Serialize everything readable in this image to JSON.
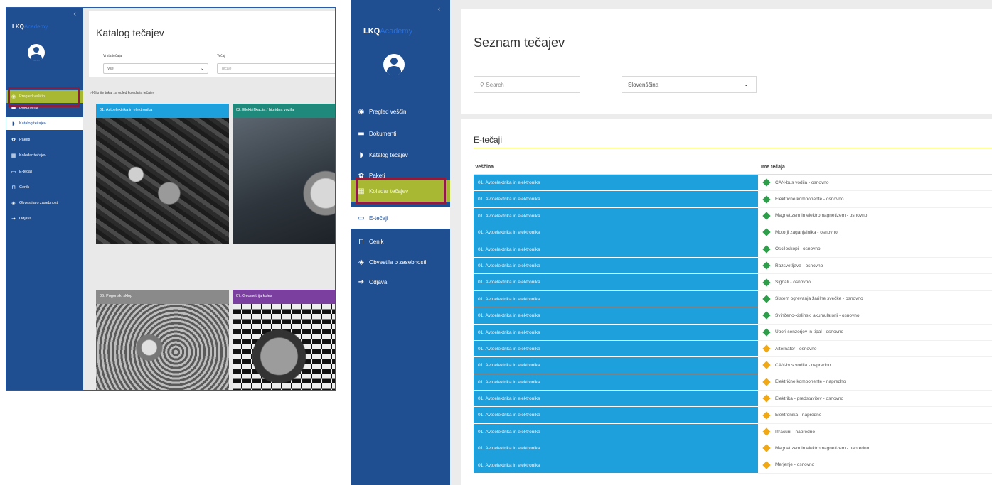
{
  "panel1": {
    "sidebar": {
      "logo_main": "LKQ",
      "logo_tail": "Academy",
      "items": [
        {
          "label": "Pregled veščin",
          "icon": "dashboard-icon"
        },
        {
          "label": "Dokumenti",
          "icon": "folder-icon"
        },
        {
          "label": "Katalog tečajev",
          "icon": "bookmark-icon"
        },
        {
          "label": "Paketi",
          "icon": "package-icon"
        },
        {
          "label": "Koledar tečajev",
          "icon": "calendar-icon"
        },
        {
          "label": "E-tečaji",
          "icon": "monitor-icon"
        },
        {
          "label": "Cenik",
          "icon": "price-tag-icon"
        },
        {
          "label": "Obvestila o zasebnosti",
          "icon": "privacy-icon"
        },
        {
          "label": "Odjava",
          "icon": "logout-icon"
        }
      ]
    },
    "header": {
      "title": "Katalog tečajev",
      "filter_type_label": "Vrsta tečaja",
      "filter_type_value": "Vse",
      "filter_course_label": "Tečaj",
      "filter_course_placeholder": "Tečaje"
    },
    "catalog_link": "Kliknite tukaj za ogled koledarja tečajev",
    "cards": [
      {
        "title": "01. Avtoelektrika in elektronika",
        "color": "#1ea0dc"
      },
      {
        "title": "02. Elektrifikacija / hibridna vozila",
        "color": "#1f8a7c"
      },
      {
        "title": "06. Pogonski sklop",
        "color": "#8a8a8a"
      },
      {
        "title": "07. Geometrija koles",
        "color": "#7b3fa0"
      }
    ]
  },
  "panel2": {
    "sidebar": {
      "logo_main": "LKQ",
      "logo_tail": "Academy",
      "items": [
        {
          "label": "Pregled veščin",
          "icon": "dashboard-icon"
        },
        {
          "label": "Dokumenti",
          "icon": "folder-icon"
        },
        {
          "label": "Katalog tečajev",
          "icon": "bookmark-icon"
        },
        {
          "label": "Paketi",
          "icon": "package-icon"
        },
        {
          "label": "Koledar tečajev",
          "icon": "calendar-icon"
        },
        {
          "label": "E-tečaji",
          "icon": "monitor-icon"
        },
        {
          "label": "Cenik",
          "icon": "price-tag-icon"
        },
        {
          "label": "Obvestila o zasebnosti",
          "icon": "privacy-icon"
        },
        {
          "label": "Odjava",
          "icon": "logout-icon"
        }
      ]
    },
    "header": {
      "title": "Seznam tečajev",
      "search_placeholder": "Search",
      "language_value": "Slovenščina"
    },
    "section_title": "E-tečaji",
    "columns": [
      "Veščina",
      "Ime tečaja"
    ],
    "level_colors": {
      "osnovno": "#2e9e4a",
      "napredno": "#f0a814"
    },
    "rows": [
      {
        "skill": "01. Avtoelektrika in elektronika",
        "course": "CAN-bus vodila - osnovno",
        "level": "osnovno"
      },
      {
        "skill": "01. Avtoelektrika in elektronika",
        "course": "Električne komponente - osnovno",
        "level": "osnovno"
      },
      {
        "skill": "01. Avtoelektrika in elektronika",
        "course": "Magnetizem in elektromagnetizem - osnovno",
        "level": "osnovno"
      },
      {
        "skill": "01. Avtoelektrika in elektronika",
        "course": "Motorji zaganjalnika - osnovno",
        "level": "osnovno"
      },
      {
        "skill": "01. Avtoelektrika in elektronika",
        "course": "Osciloskopi - osnovno",
        "level": "osnovno"
      },
      {
        "skill": "01. Avtoelektrika in elektronika",
        "course": "Razsvetljava - osnovno",
        "level": "osnovno"
      },
      {
        "skill": "01. Avtoelektrika in elektronika",
        "course": "Signali - osnovno",
        "level": "osnovno"
      },
      {
        "skill": "01. Avtoelektrika in elektronika",
        "course": "Sistem ogrevanja žarilne svečke - osnovno",
        "level": "osnovno"
      },
      {
        "skill": "01. Avtoelektrika in elektronika",
        "course": "Svinčeno-kislinski akumulatorji - osnovno",
        "level": "osnovno"
      },
      {
        "skill": "01. Avtoelektrika in elektronika",
        "course": "Upori senzorjev in tipal - osnovno",
        "level": "osnovno"
      },
      {
        "skill": "01. Avtoelektrika in elektronika",
        "course": "Alternator - osnovno",
        "level": "napredno"
      },
      {
        "skill": "01. Avtoelektrika in elektronika",
        "course": "CAN-bus vodila - napredno",
        "level": "napredno"
      },
      {
        "skill": "01. Avtoelektrika in elektronika",
        "course": "Električne komponente - napredno",
        "level": "napredno"
      },
      {
        "skill": "01. Avtoelektrika in elektronika",
        "course": "Elektrika - predstavitev - osnovno",
        "level": "napredno"
      },
      {
        "skill": "01. Avtoelektrika in elektronika",
        "course": "Elektronika - napredno",
        "level": "napredno"
      },
      {
        "skill": "01. Avtoelektrika in elektronika",
        "course": "Izračuni - napredno",
        "level": "napredno"
      },
      {
        "skill": "01. Avtoelektrika in elektronika",
        "course": "Magnetizem in elektromagnetizem - napredno",
        "level": "napredno"
      },
      {
        "skill": "01. Avtoelektrika in elektronika",
        "course": "Merjenje - osnovno",
        "level": "napredno"
      }
    ]
  }
}
